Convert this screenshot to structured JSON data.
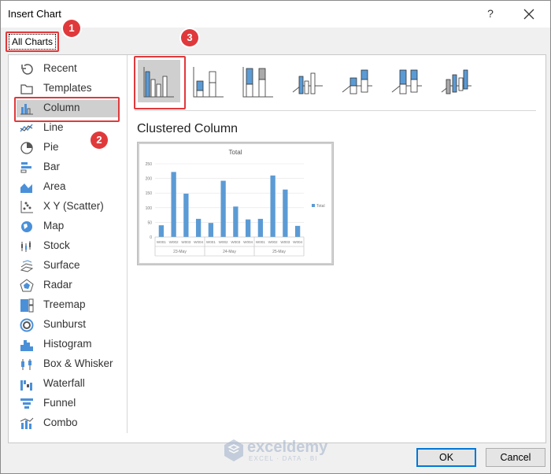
{
  "window": {
    "title": "Insert Chart",
    "help_label": "?"
  },
  "tab_all_charts": "All Charts",
  "badges": [
    "1",
    "2",
    "3"
  ],
  "sidebar": {
    "items": [
      {
        "label": "Recent",
        "icon": "recent-icon"
      },
      {
        "label": "Templates",
        "icon": "templates-icon"
      },
      {
        "label": "Column",
        "icon": "column-chart-icon",
        "selected": true
      },
      {
        "label": "Line",
        "icon": "line-chart-icon"
      },
      {
        "label": "Pie",
        "icon": "pie-chart-icon"
      },
      {
        "label": "Bar",
        "icon": "bar-chart-icon"
      },
      {
        "label": "Area",
        "icon": "area-chart-icon"
      },
      {
        "label": "X Y (Scatter)",
        "icon": "scatter-chart-icon"
      },
      {
        "label": "Map",
        "icon": "map-chart-icon"
      },
      {
        "label": "Stock",
        "icon": "stock-chart-icon"
      },
      {
        "label": "Surface",
        "icon": "surface-chart-icon"
      },
      {
        "label": "Radar",
        "icon": "radar-chart-icon"
      },
      {
        "label": "Treemap",
        "icon": "treemap-chart-icon"
      },
      {
        "label": "Sunburst",
        "icon": "sunburst-chart-icon"
      },
      {
        "label": "Histogram",
        "icon": "histogram-chart-icon"
      },
      {
        "label": "Box & Whisker",
        "icon": "box-whisker-chart-icon"
      },
      {
        "label": "Waterfall",
        "icon": "waterfall-chart-icon"
      },
      {
        "label": "Funnel",
        "icon": "funnel-chart-icon"
      },
      {
        "label": "Combo",
        "icon": "combo-chart-icon"
      }
    ]
  },
  "subtypes": [
    "clustered-column",
    "stacked-column",
    "100-stacked-column",
    "3d-clustered-column",
    "3d-stacked-column",
    "3d-100-stacked-column",
    "3d-column"
  ],
  "selected_subtype_name": "Clustered Column",
  "chart_data": {
    "type": "bar",
    "title": "Total",
    "categories": [
      "W001",
      "W002",
      "W003",
      "W004",
      "W001",
      "W002",
      "W003",
      "W004",
      "W001",
      "W002",
      "W003",
      "W004"
    ],
    "groups": [
      "23-May",
      "24-May",
      "25-May"
    ],
    "series": [
      {
        "name": "Total",
        "values": [
          40,
          222,
          148,
          62,
          48,
          192,
          104,
          60,
          62,
          210,
          162,
          38
        ]
      }
    ],
    "ylim": [
      0,
      250
    ],
    "yticks": [
      "0",
      "50",
      "100",
      "150",
      "200",
      "250"
    ],
    "legend": "right",
    "grid": true
  },
  "buttons": {
    "ok": "OK",
    "cancel": "Cancel"
  },
  "watermark": {
    "name": "exceldemy",
    "tagline": "EXCEL · DATA · BI"
  },
  "colors": {
    "accent": "#0078d7",
    "highlight": "#e0393b",
    "series": "#5b9bd5",
    "selected_bg": "#cfcfcf"
  }
}
